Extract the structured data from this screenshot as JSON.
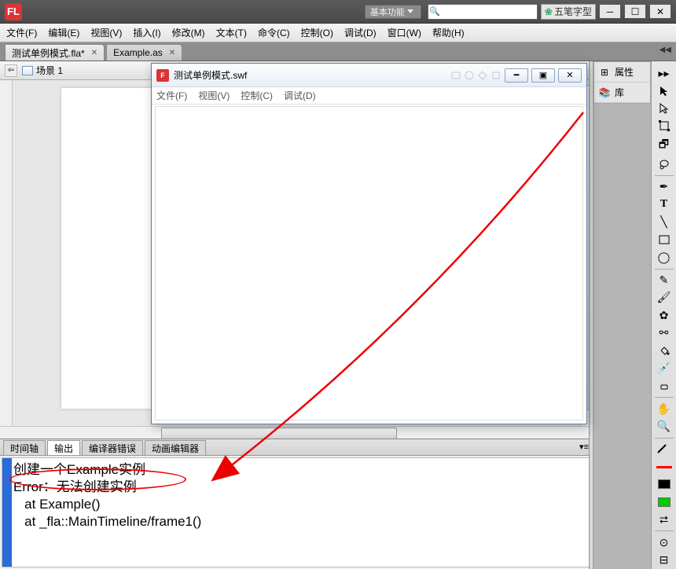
{
  "titlebar": {
    "logo": "FL",
    "workspace": "基本功能",
    "ime": "五笔字型"
  },
  "menubar": {
    "items": [
      "文件(F)",
      "编辑(E)",
      "视图(V)",
      "插入(I)",
      "修改(M)",
      "文本(T)",
      "命令(C)",
      "控制(O)",
      "调试(D)",
      "窗口(W)",
      "帮助(H)"
    ]
  },
  "doctabs": {
    "tab0": "测试单例模式.fla*",
    "tab1": "Example.as"
  },
  "scene": {
    "label": "场景 1"
  },
  "rpanel": {
    "props": "属性",
    "library": "库"
  },
  "bottomTabs": {
    "t0": "时间轴",
    "t1": "输出",
    "t2": "编译器错误",
    "t3": "动画编辑器"
  },
  "output": {
    "line0": "创建一个Example实例",
    "line1": "Error：无法创建实例",
    "line2": "   at Example()",
    "line3": "   at _fla::MainTimeline/frame1()"
  },
  "swf": {
    "title": "测试单例模式.swf",
    "menu": [
      "文件(F)",
      "视图(V)",
      "控制(C)",
      "调试(D)"
    ]
  },
  "tools_alt": {
    "arrow": "selection",
    "subselect": "subselection",
    "free": "free-transform",
    "gradient": "gradient-transform",
    "lasso": "lasso",
    "pen": "pen",
    "text": "text",
    "line": "line",
    "rect": "rectangle",
    "oval": "oval",
    "polystar": "polystar",
    "pencil": "pencil",
    "brush": "brush",
    "deco": "deco",
    "bone": "bone",
    "bucket": "paint-bucket",
    "dropper": "eyedropper",
    "eraser": "eraser",
    "hand": "hand",
    "zoom": "zoom"
  }
}
